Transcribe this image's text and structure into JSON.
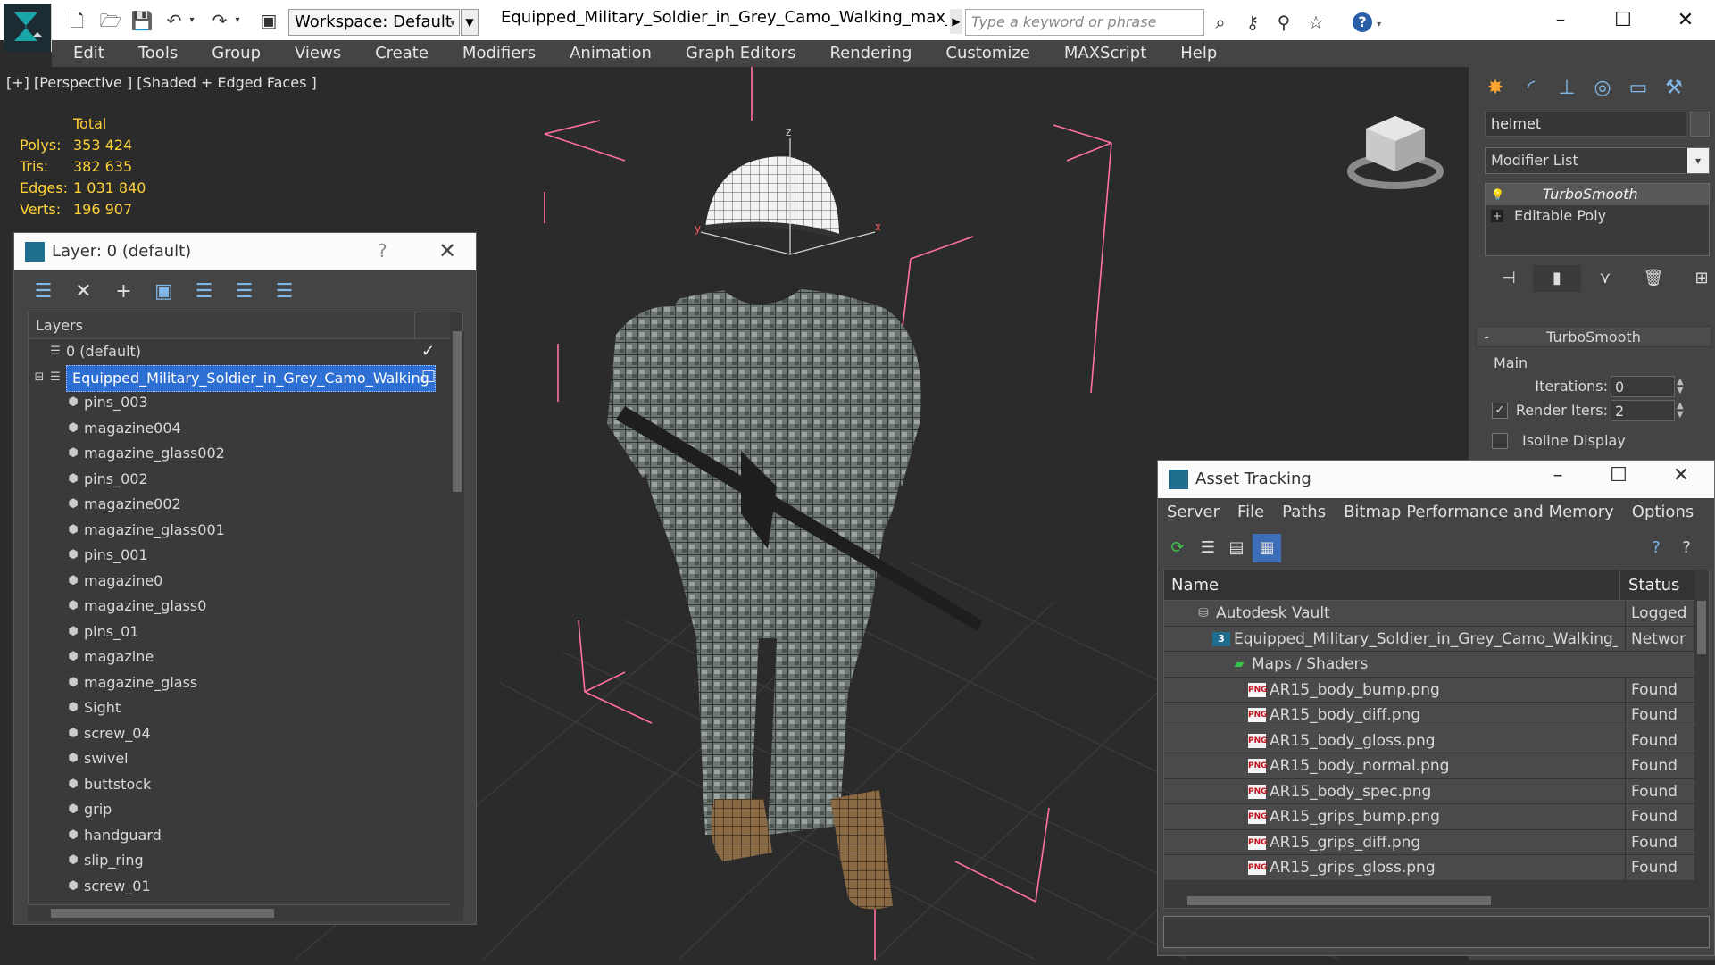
{
  "titlebar": {
    "workspace_label": "Workspace: Default",
    "doc_title": "Equipped_Military_Soldier_in_Grey_Camo_Walking_max_vray....",
    "search_placeholder": "Type a keyword or phrase",
    "help_label": "?"
  },
  "menu": [
    "Edit",
    "Tools",
    "Group",
    "Views",
    "Create",
    "Modifiers",
    "Animation",
    "Graph Editors",
    "Rendering",
    "Customize",
    "MAXScript",
    "Help"
  ],
  "viewport": {
    "label": "[+] [Perspective ] [Shaded + Edged Faces ]",
    "stats": {
      "total_label": "Total",
      "rows": [
        {
          "key": "Polys:",
          "value": "353 424"
        },
        {
          "key": "Tris:",
          "value": "382 635"
        },
        {
          "key": "Edges:",
          "value": "1 031 840"
        },
        {
          "key": "Verts:",
          "value": "196 907"
        }
      ]
    },
    "gizmo_axis_z": "z",
    "gizmo_axis_y": "y",
    "gizmo_axis_x": "x"
  },
  "layer_dialog": {
    "title": "Layer: 0 (default)",
    "help": "?",
    "header": "Layers",
    "rows": [
      {
        "label": "0 (default)",
        "level": 0,
        "mark": "✓"
      },
      {
        "label": "Equipped_Military_Soldier_in_Grey_Camo_Walking",
        "level": 0,
        "selected": true,
        "mark": "☐"
      },
      {
        "label": "pins_003",
        "level": 1
      },
      {
        "label": "magazine004",
        "level": 1
      },
      {
        "label": "magazine_glass002",
        "level": 1
      },
      {
        "label": "pins_002",
        "level": 1
      },
      {
        "label": "magazine002",
        "level": 1
      },
      {
        "label": "magazine_glass001",
        "level": 1
      },
      {
        "label": "pins_001",
        "level": 1
      },
      {
        "label": "magazine0",
        "level": 1
      },
      {
        "label": "magazine_glass0",
        "level": 1
      },
      {
        "label": "pins_01",
        "level": 1
      },
      {
        "label": "magazine",
        "level": 1
      },
      {
        "label": "magazine_glass",
        "level": 1
      },
      {
        "label": "Sight",
        "level": 1
      },
      {
        "label": "screw_04",
        "level": 1
      },
      {
        "label": "swivel",
        "level": 1
      },
      {
        "label": "buttstock",
        "level": 1
      },
      {
        "label": "grip",
        "level": 1
      },
      {
        "label": "handguard",
        "level": 1
      },
      {
        "label": "slip_ring",
        "level": 1
      },
      {
        "label": "screw_01",
        "level": 1
      }
    ]
  },
  "command_panel": {
    "object_name": "helmet",
    "modifier_list": "Modifier List",
    "stack": [
      {
        "label": "TurboSmooth",
        "active": true,
        "bullet": "💡"
      },
      {
        "label": "Editable Poly",
        "active": false,
        "bullet": "+"
      }
    ],
    "rollout": {
      "title": "TurboSmooth",
      "minus": "-",
      "group": "Main",
      "iterations_label": "Iterations:",
      "iterations_value": "0",
      "render_iters_label": "Render Iters:",
      "render_iters_value": "2",
      "render_iters_checked": "✓",
      "isoline_label": "Isoline Display"
    }
  },
  "asset_tracking": {
    "title": "Asset Tracking",
    "menu": [
      "Server",
      "File",
      "Paths",
      "Bitmap Performance and Memory",
      "Options"
    ],
    "columns": {
      "name": "Name",
      "status": "Status"
    },
    "rows": [
      {
        "name": "Autodesk Vault",
        "status": "Logged",
        "indent": 1,
        "icon": "vault"
      },
      {
        "name": "Equipped_Military_Soldier_in_Grey_Camo_Walking_...",
        "status": "Networ",
        "indent": 2,
        "icon": "max"
      },
      {
        "name": "Maps / Shaders",
        "status": "",
        "indent": 3,
        "icon": "maps"
      },
      {
        "name": "AR15_body_bump.png",
        "status": "Found",
        "indent": 4,
        "icon": "png"
      },
      {
        "name": "AR15_body_diff.png",
        "status": "Found",
        "indent": 4,
        "icon": "png"
      },
      {
        "name": "AR15_body_gloss.png",
        "status": "Found",
        "indent": 4,
        "icon": "png"
      },
      {
        "name": "AR15_body_normal.png",
        "status": "Found",
        "indent": 4,
        "icon": "png"
      },
      {
        "name": "AR15_body_spec.png",
        "status": "Found",
        "indent": 4,
        "icon": "png"
      },
      {
        "name": "AR15_grips_bump.png",
        "status": "Found",
        "indent": 4,
        "icon": "png"
      },
      {
        "name": "AR15_grips_diff.png",
        "status": "Found",
        "indent": 4,
        "icon": "png"
      },
      {
        "name": "AR15_grips_gloss.png",
        "status": "Found",
        "indent": 4,
        "icon": "png"
      }
    ],
    "png_badge": "PNG"
  },
  "colors": {
    "accent": "#2d6fd2",
    "stats_yellow": "#ffd23a",
    "bbox_pink": "#ff6fa8",
    "panel_bg": "#444444",
    "viewport_bg": "#2b2b2b"
  }
}
